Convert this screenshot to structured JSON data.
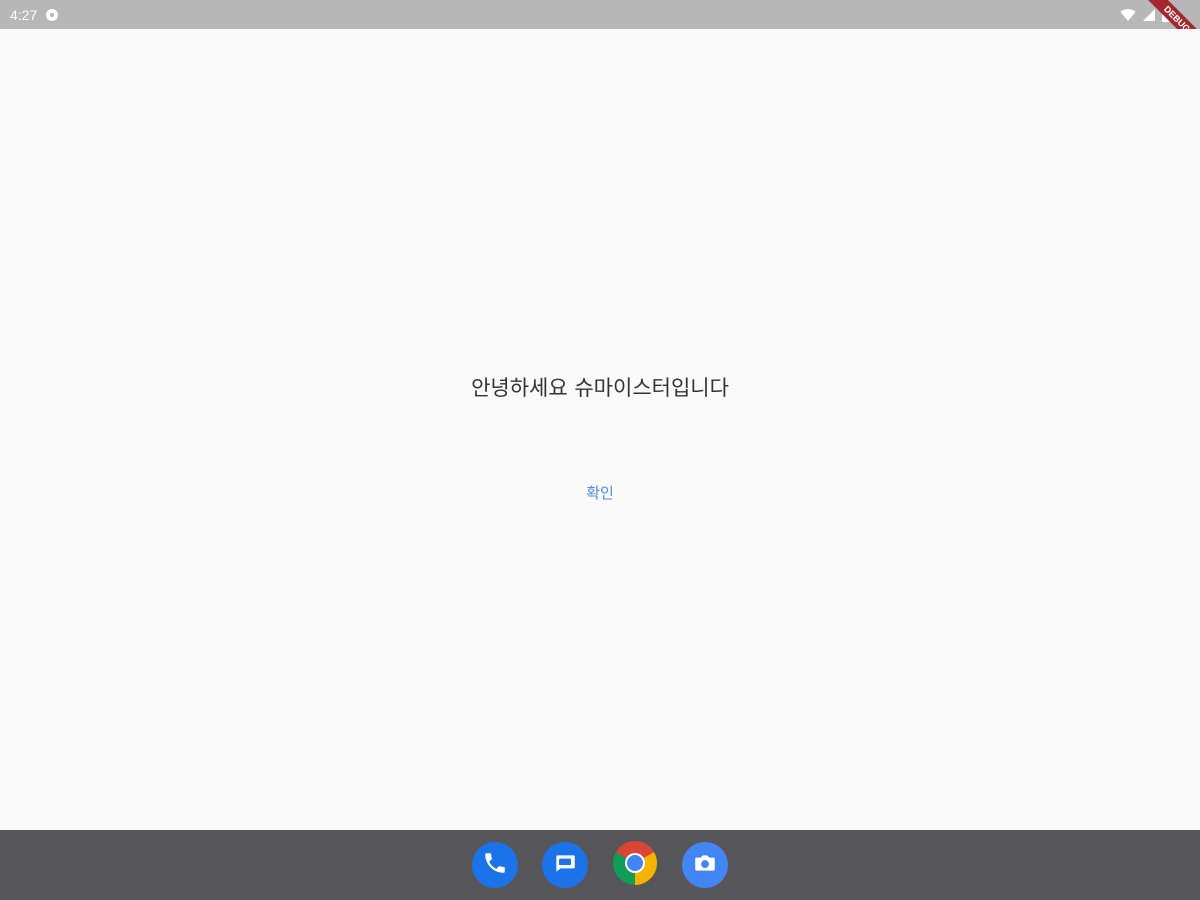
{
  "status_bar": {
    "time": "4:27"
  },
  "debug_banner": {
    "label": "DEBUG"
  },
  "main": {
    "greeting": "안녕하세요 슈마이스터입니다",
    "confirm_label": "확인"
  },
  "dock": {
    "apps": [
      "phone-icon",
      "messages-icon",
      "chrome-icon",
      "camera-icon"
    ]
  },
  "colors": {
    "status_bar_bg": "#b7b7b7",
    "background": "#fafafa",
    "button_text": "#4a90e2",
    "dock_bg": "#56565a",
    "debug_ribbon": "#a6262d"
  }
}
